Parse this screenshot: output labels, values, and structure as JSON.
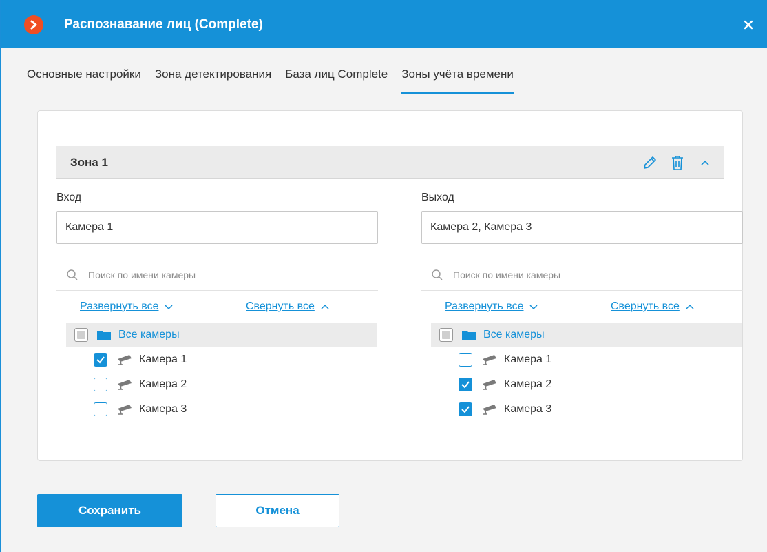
{
  "window": {
    "title": "Распознавание лиц (Complete)",
    "close_label": "✕"
  },
  "tabs": [
    {
      "label": "Основные настройки",
      "active": false
    },
    {
      "label": "Зона детектирования",
      "active": false
    },
    {
      "label": "База лиц Complete",
      "active": false
    },
    {
      "label": "Зоны учёта времени",
      "active": true
    }
  ],
  "zone": {
    "title": "Зона 1",
    "actions": [
      "pencil-icon",
      "trash-icon",
      "chevron-up-icon"
    ]
  },
  "entry": {
    "label": "Вход",
    "value": "Камера 1",
    "search_placeholder": "Поиск по имени камеры",
    "expand_all": "Развернуть все",
    "collapse_all": "Свернуть все",
    "root_label": "Все камеры",
    "cameras": [
      {
        "label": "Камера 1",
        "checked": true
      },
      {
        "label": "Камера 2",
        "checked": false
      },
      {
        "label": "Камера 3",
        "checked": false
      }
    ]
  },
  "exit": {
    "label": "Выход",
    "value": "Камера 2, Камера 3",
    "search_placeholder": "Поиск по имени камеры",
    "expand_all": "Развернуть все",
    "collapse_all": "Свернуть все",
    "root_label": "Все камеры",
    "cameras": [
      {
        "label": "Камера 1",
        "checked": false
      },
      {
        "label": "Камера 2",
        "checked": true
      },
      {
        "label": "Камера 3",
        "checked": true
      }
    ]
  },
  "buttons": {
    "save": "Сохранить",
    "cancel": "Отмена"
  },
  "colors": {
    "accent": "#1591d8",
    "logo": "#f04e23"
  }
}
